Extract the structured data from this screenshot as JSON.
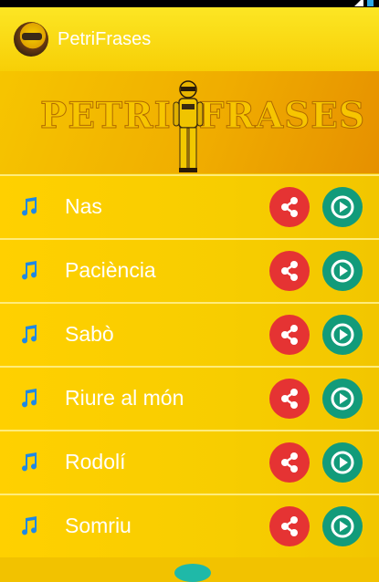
{
  "app": {
    "title": "PetriFrases",
    "banner_left": "PETRI",
    "banner_right": "FRASES"
  },
  "colors": {
    "share": "#e53333",
    "play": "#129b7a",
    "note": "#1e88e5",
    "text": "#ffffff"
  },
  "icons": {
    "note": "music-note-icon",
    "share": "share-icon",
    "play": "play-icon"
  },
  "items": [
    {
      "label": "Nas"
    },
    {
      "label": "Paciència"
    },
    {
      "label": "Sabò"
    },
    {
      "label": "Riure al món"
    },
    {
      "label": "Rodolí"
    },
    {
      "label": "Somriu"
    }
  ]
}
